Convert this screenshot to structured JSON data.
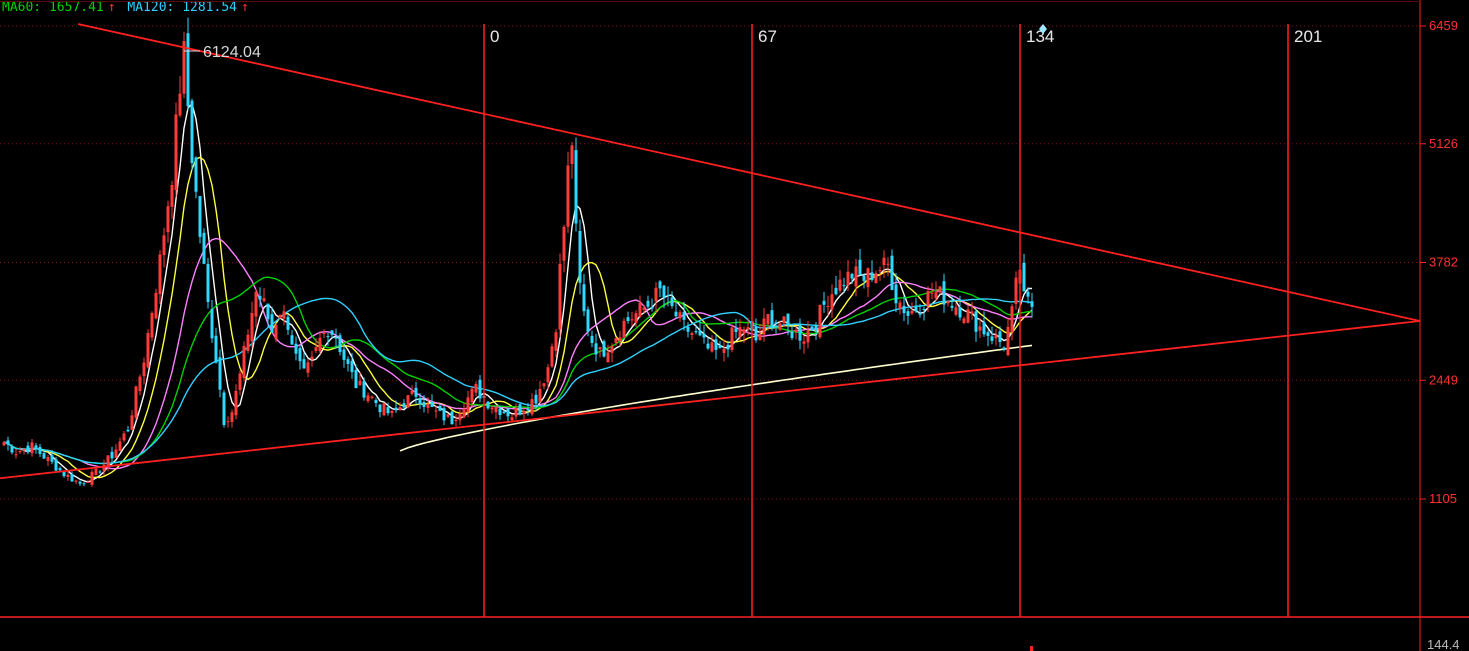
{
  "legend": {
    "ma60_label": "MA60: 1657.41",
    "ma60_arrow": "↑",
    "ma60_color": "#00d000",
    "ma120_label": "MA120: 1281.54",
    "ma120_arrow": "↑",
    "ma120_color": "#30d0ff",
    "arrow_color": "#ff3030"
  },
  "chart_data": {
    "type": "candlestick",
    "y_ticks": [
      6459,
      5126,
      3782,
      2449,
      1105
    ],
    "y_bottom_label": "144.4",
    "ylim": [
      106,
      6530
    ],
    "cycle_markers": [
      {
        "label": "0",
        "bar": 0
      },
      {
        "label": "67",
        "bar": 67
      },
      {
        "label": "134",
        "bar": 134
      },
      {
        "label": "201",
        "bar": 201
      }
    ],
    "peak_annotation": "6124.04",
    "price_path": [
      [
        -120,
        1750
      ],
      [
        -117,
        1640
      ],
      [
        -113,
        1700
      ],
      [
        -109,
        1550
      ],
      [
        -105,
        1390
      ],
      [
        -101,
        1280
      ],
      [
        -97,
        1400
      ],
      [
        -93,
        1600
      ],
      [
        -89,
        1900
      ],
      [
        -85,
        2700
      ],
      [
        -81,
        3800
      ],
      [
        -78,
        4800
      ],
      [
        -76,
        5800
      ],
      [
        -75,
        6124
      ],
      [
        -73,
        5000
      ],
      [
        -71,
        4100
      ],
      [
        -69,
        3300
      ],
      [
        -67,
        2700
      ],
      [
        -65,
        2000
      ],
      [
        -63,
        2100
      ],
      [
        -61,
        2500
      ],
      [
        -59,
        3000
      ],
      [
        -57,
        3450
      ],
      [
        -55,
        3300
      ],
      [
        -53,
        3000
      ],
      [
        -51,
        3250
      ],
      [
        -49,
        3100
      ],
      [
        -47,
        2700
      ],
      [
        -45,
        2500
      ],
      [
        -43,
        2650
      ],
      [
        -41,
        2900
      ],
      [
        -39,
        3050
      ],
      [
        -37,
        2950
      ],
      [
        -35,
        2700
      ],
      [
        -32,
        2400
      ],
      [
        -29,
        2300
      ],
      [
        -26,
        2150
      ],
      [
        -23,
        2050
      ],
      [
        -20,
        2200
      ],
      [
        -17,
        2300
      ],
      [
        -14,
        2150
      ],
      [
        -11,
        2050
      ],
      [
        -8,
        2000
      ],
      [
        -5,
        2200
      ],
      [
        -2,
        2350
      ],
      [
        1,
        2200
      ],
      [
        4,
        2120
      ],
      [
        7,
        2060
      ],
      [
        10,
        2150
      ],
      [
        13,
        2250
      ],
      [
        16,
        2600
      ],
      [
        18,
        3100
      ],
      [
        19,
        3700
      ],
      [
        20,
        4200
      ],
      [
        21,
        4800
      ],
      [
        22,
        5166
      ],
      [
        23,
        4100
      ],
      [
        24,
        3500
      ],
      [
        25,
        3200
      ],
      [
        27,
        2900
      ],
      [
        29,
        2750
      ],
      [
        32,
        2900
      ],
      [
        35,
        3100
      ],
      [
        38,
        3200
      ],
      [
        41,
        3300
      ],
      [
        44,
        3450
      ],
      [
        47,
        3250
      ],
      [
        50,
        3050
      ],
      [
        53,
        2950
      ],
      [
        56,
        2800
      ],
      [
        59,
        2750
      ],
      [
        62,
        2950
      ],
      [
        65,
        3050
      ],
      [
        68,
        2900
      ],
      [
        71,
        3150
      ],
      [
        74,
        3100
      ],
      [
        77,
        3000
      ],
      [
        80,
        2950
      ],
      [
        83,
        3100
      ],
      [
        86,
        3400
      ],
      [
        89,
        3550
      ],
      [
        92,
        3650
      ],
      [
        95,
        3600
      ],
      [
        98,
        3700
      ],
      [
        101,
        3750
      ],
      [
        103,
        3400
      ],
      [
        106,
        3200
      ],
      [
        109,
        3300
      ],
      [
        112,
        3450
      ],
      [
        115,
        3400
      ],
      [
        118,
        3300
      ],
      [
        121,
        3200
      ],
      [
        124,
        3050
      ],
      [
        127,
        2950
      ],
      [
        130,
        2850
      ],
      [
        132,
        3200
      ],
      [
        133,
        3500
      ],
      [
        134,
        3730
      ],
      [
        135,
        3350
      ],
      [
        137,
        3300
      ]
    ],
    "trendlines": {
      "upper": [
        [
          -101,
          6480
        ],
        [
          234,
          3120
        ]
      ],
      "lower": [
        [
          -120,
          1340
        ],
        [
          234,
          3120
        ]
      ],
      "support": [
        [
          -21,
          1650
        ],
        [
          138,
          2850
        ]
      ]
    }
  }
}
